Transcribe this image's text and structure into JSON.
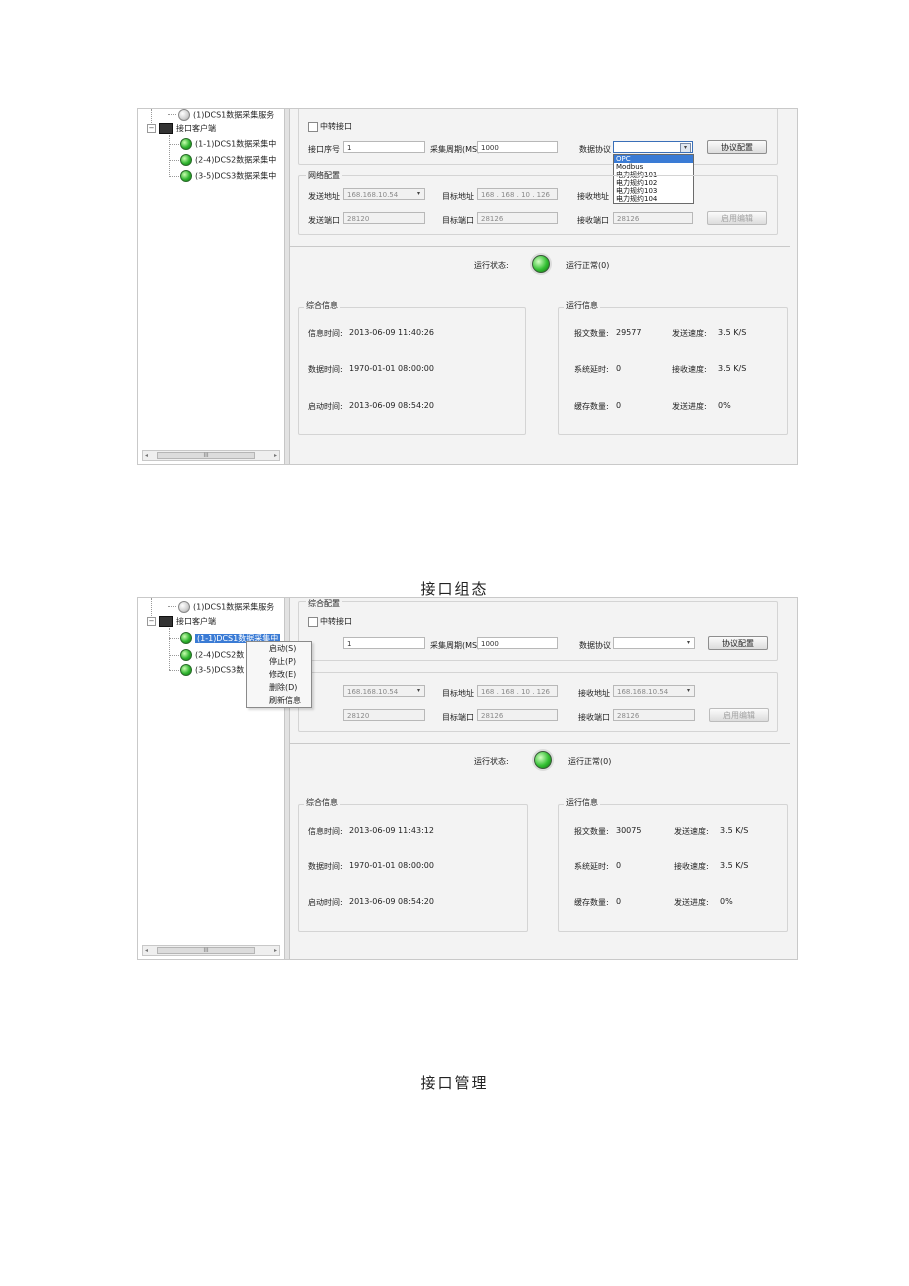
{
  "screen1": {
    "tree": {
      "item_top": "(1)DCS1数据采集服务",
      "clients": "接口客户端",
      "c1": "(1-1)DCS1数据采集中",
      "c2": "(2-4)DCS2数据采集中",
      "c3": "(3-5)DCS3数据采集中",
      "scroll_mark": "III"
    },
    "relay_label": "中转接口",
    "port_no_label": "接口序号",
    "port_no": "1",
    "period_label": "采集周期(MS)",
    "period": "1000",
    "protocol_label": "数据协议",
    "protocol_value": "",
    "protocol_btn": "协议配置",
    "protocol_options": [
      "OPC",
      "Modbus",
      "电力规约101",
      "电力规约102",
      "电力规约103",
      "电力规约104"
    ],
    "net_title": "网络配置",
    "send_addr_label": "发送地址",
    "send_addr": "168.168.10.54",
    "target_addr_label": "目标地址",
    "target_addr": "168 . 168 . 10 . 126",
    "recv_addr_label": "接收地址",
    "send_port_label": "发送端口",
    "send_port": "28120",
    "target_port_label": "目标端口",
    "target_port": "28126",
    "recv_port_label": "接收端口",
    "recv_port": "28126",
    "enable_edit_btn": "启用编辑",
    "run_state_label": "运行状态:",
    "run_state_value": "运行正常(0)",
    "summary_title": "综合信息",
    "info_time_label": "信息时间:",
    "info_time": "2013-06-09 11:40:26",
    "data_time_label": "数据时间:",
    "data_time": "1970-01-01 08:00:00",
    "start_time_label": "启动时间:",
    "start_time": "2013-06-09 08:54:20",
    "run_title": "运行信息",
    "msg_count_label": "报文数量:",
    "msg_count": "29577",
    "send_speed_label": "发送速度:",
    "send_speed": "3.5 K/S",
    "sys_delay_label": "系统延时:",
    "sys_delay": "0",
    "recv_speed_label": "接收速度:",
    "recv_speed": "3.5 K/S",
    "cache_label": "缓存数量:",
    "cache": "0",
    "send_progress_label": "发送进度:",
    "send_progress": "0%"
  },
  "caption1": "接口组态",
  "screen2": {
    "tree": {
      "item_top": "(1)DCS1数据采集服务",
      "clients": "接口客户端",
      "c1": "(1-1)DCS1数据采集中",
      "c2": "(2-4)DCS2数",
      "c3": "(3-5)DCS3数",
      "scroll_mark": "III"
    },
    "context_menu": [
      "启动(S)",
      "停止(P)",
      "修改(E)",
      "删除(D)",
      "刷新信息"
    ],
    "summary_group_title": "综合配置",
    "relay_label": "中转接口",
    "port_no": "1",
    "period_label": "采集周期(MS)",
    "period": "1000",
    "protocol_label": "数据协议",
    "protocol_btn": "协议配置",
    "send_addr": "168.168.10.54",
    "target_addr_label": "目标地址",
    "target_addr": "168 . 168 . 10 . 126",
    "recv_addr_label": "接收地址",
    "recv_addr": "168.168.10.54",
    "send_port": "28120",
    "target_port_label": "目标端口",
    "target_port": "28126",
    "recv_port_label": "接收端口",
    "recv_port": "28126",
    "enable_edit_btn": "启用编辑",
    "run_state_label": "运行状态:",
    "run_state_value": "运行正常(0)",
    "summary_title": "综合信息",
    "info_time_label": "信息时间:",
    "info_time": "2013-06-09 11:43:12",
    "data_time_label": "数据时间:",
    "data_time": "1970-01-01 08:00:00",
    "start_time_label": "启动时间:",
    "start_time": "2013-06-09 08:54:20",
    "run_title": "运行信息",
    "msg_count_label": "报文数量:",
    "msg_count": "30075",
    "send_speed_label": "发送速度:",
    "send_speed": "3.5 K/S",
    "sys_delay_label": "系统延时:",
    "sys_delay": "0",
    "recv_speed_label": "接收速度:",
    "recv_speed": "3.5 K/S",
    "cache_label": "缓存数量:",
    "cache": "0",
    "send_progress_label": "发送进度:",
    "send_progress": "0%"
  },
  "caption2": "接口管理"
}
